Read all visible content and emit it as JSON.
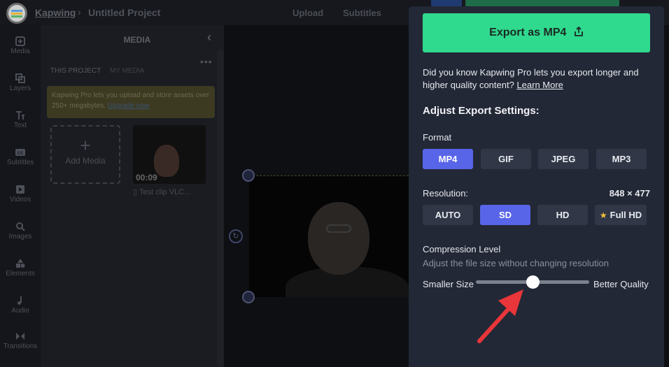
{
  "topbar": {
    "brand": "Kapwing",
    "separator": "›",
    "project_title": "Untitled Project",
    "nav": [
      "Upload",
      "Subtitles"
    ]
  },
  "rail": {
    "items": [
      {
        "label": "Media",
        "icon": "media-icon"
      },
      {
        "label": "Layers",
        "icon": "layers-icon"
      },
      {
        "label": "Text",
        "icon": "text-icon"
      },
      {
        "label": "Subtitles",
        "icon": "subtitles-icon"
      },
      {
        "label": "Videos",
        "icon": "videos-icon"
      },
      {
        "label": "Images",
        "icon": "images-icon"
      },
      {
        "label": "Elements",
        "icon": "elements-icon"
      },
      {
        "label": "Audio",
        "icon": "audio-icon"
      },
      {
        "label": "Transitions",
        "icon": "transitions-icon"
      }
    ]
  },
  "media": {
    "title": "MEDIA",
    "tabs": [
      "THIS PROJECT",
      "MY MEDIA"
    ],
    "promo_text": "Kapwing Pro lets you upload and store assets over 250+ megabytes.",
    "promo_link": "Upgrade now",
    "add_media": "Add Media",
    "clip_duration": "00:09",
    "clip_name": "Test clip VLC..."
  },
  "export": {
    "button_label": "Export as MP4",
    "pro_note": "Did you know Kapwing Pro lets you export longer and higher quality content?",
    "learn_more": "Learn More",
    "section_title": "Adjust Export Settings:",
    "format_label": "Format",
    "formats": [
      "MP4",
      "GIF",
      "JPEG",
      "MP3"
    ],
    "selected_format": "MP4",
    "resolution_label": "Resolution:",
    "resolution_value": "848 × 477",
    "resolutions": [
      "AUTO",
      "SD",
      "HD",
      "Full HD"
    ],
    "selected_resolution": "SD",
    "compression_label": "Compression Level",
    "compression_sub": "Adjust the file size without changing resolution",
    "slider_min_label": "Smaller Size",
    "slider_max_label": "Better Quality",
    "compression_value": 0.5
  },
  "colors": {
    "export_green": "#2fd98e",
    "selected_purple": "#5865e8",
    "panel_bg": "#232836",
    "arrow_red": "#e8363a"
  }
}
